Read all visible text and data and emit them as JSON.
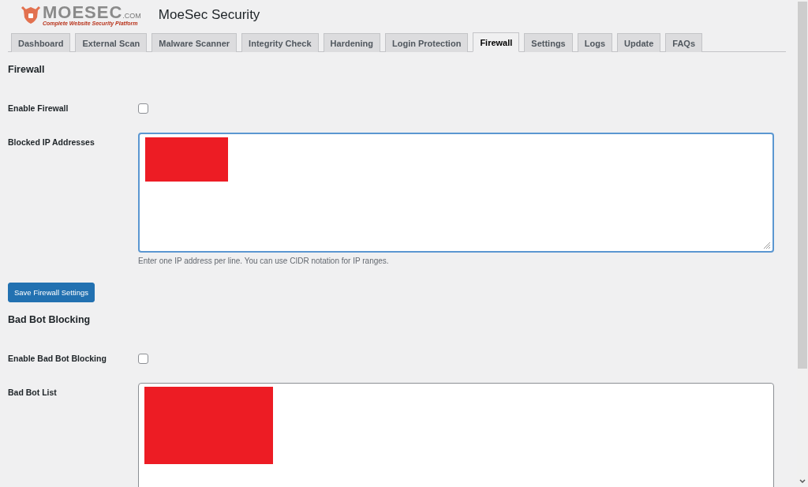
{
  "header": {
    "logo": {
      "wordmark": "MOESEC",
      "suffix": ".COM",
      "tagline": "Complete Website Security Platform"
    },
    "title": "MoeSec Security"
  },
  "tabs": [
    {
      "label": "Dashboard",
      "selected": false
    },
    {
      "label": "External Scan",
      "selected": false
    },
    {
      "label": "Malware Scanner",
      "selected": false
    },
    {
      "label": "Integrity Check",
      "selected": false
    },
    {
      "label": "Hardening",
      "selected": false
    },
    {
      "label": "Login Protection",
      "selected": false
    },
    {
      "label": "Firewall",
      "selected": true
    },
    {
      "label": "Settings",
      "selected": false
    },
    {
      "label": "Logs",
      "selected": false
    },
    {
      "label": "Update",
      "selected": false
    },
    {
      "label": "FAQs",
      "selected": false
    }
  ],
  "sections": [
    {
      "heading": "Firewall",
      "rows": [
        {
          "kind": "checkbox",
          "label": "Enable Firewall",
          "checked": false
        },
        {
          "kind": "textarea",
          "label": "Blocked IP Addresses",
          "focused": true,
          "description": "Enter one IP address per line. You can use CIDR notation for IP ranges."
        }
      ],
      "button": "Save Firewall Settings"
    },
    {
      "heading": "Bad Bot Blocking",
      "rows": [
        {
          "kind": "checkbox",
          "label": "Enable Bad Bot Blocking",
          "checked": false
        },
        {
          "kind": "textarea",
          "label": "Bad Bot List",
          "focused": false
        }
      ]
    }
  ]
}
